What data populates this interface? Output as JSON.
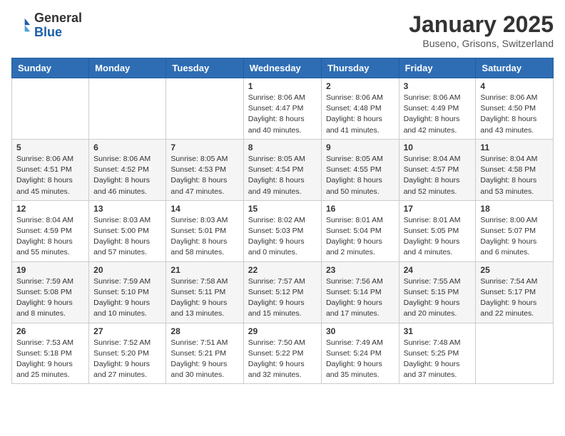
{
  "header": {
    "logo_general": "General",
    "logo_blue": "Blue",
    "month_title": "January 2025",
    "location": "Buseno, Grisons, Switzerland"
  },
  "days_of_week": [
    "Sunday",
    "Monday",
    "Tuesday",
    "Wednesday",
    "Thursday",
    "Friday",
    "Saturday"
  ],
  "weeks": [
    [
      {
        "day": "",
        "info": ""
      },
      {
        "day": "",
        "info": ""
      },
      {
        "day": "",
        "info": ""
      },
      {
        "day": "1",
        "info": "Sunrise: 8:06 AM\nSunset: 4:47 PM\nDaylight: 8 hours\nand 40 minutes."
      },
      {
        "day": "2",
        "info": "Sunrise: 8:06 AM\nSunset: 4:48 PM\nDaylight: 8 hours\nand 41 minutes."
      },
      {
        "day": "3",
        "info": "Sunrise: 8:06 AM\nSunset: 4:49 PM\nDaylight: 8 hours\nand 42 minutes."
      },
      {
        "day": "4",
        "info": "Sunrise: 8:06 AM\nSunset: 4:50 PM\nDaylight: 8 hours\nand 43 minutes."
      }
    ],
    [
      {
        "day": "5",
        "info": "Sunrise: 8:06 AM\nSunset: 4:51 PM\nDaylight: 8 hours\nand 45 minutes."
      },
      {
        "day": "6",
        "info": "Sunrise: 8:06 AM\nSunset: 4:52 PM\nDaylight: 8 hours\nand 46 minutes."
      },
      {
        "day": "7",
        "info": "Sunrise: 8:05 AM\nSunset: 4:53 PM\nDaylight: 8 hours\nand 47 minutes."
      },
      {
        "day": "8",
        "info": "Sunrise: 8:05 AM\nSunset: 4:54 PM\nDaylight: 8 hours\nand 49 minutes."
      },
      {
        "day": "9",
        "info": "Sunrise: 8:05 AM\nSunset: 4:55 PM\nDaylight: 8 hours\nand 50 minutes."
      },
      {
        "day": "10",
        "info": "Sunrise: 8:04 AM\nSunset: 4:57 PM\nDaylight: 8 hours\nand 52 minutes."
      },
      {
        "day": "11",
        "info": "Sunrise: 8:04 AM\nSunset: 4:58 PM\nDaylight: 8 hours\nand 53 minutes."
      }
    ],
    [
      {
        "day": "12",
        "info": "Sunrise: 8:04 AM\nSunset: 4:59 PM\nDaylight: 8 hours\nand 55 minutes."
      },
      {
        "day": "13",
        "info": "Sunrise: 8:03 AM\nSunset: 5:00 PM\nDaylight: 8 hours\nand 57 minutes."
      },
      {
        "day": "14",
        "info": "Sunrise: 8:03 AM\nSunset: 5:01 PM\nDaylight: 8 hours\nand 58 minutes."
      },
      {
        "day": "15",
        "info": "Sunrise: 8:02 AM\nSunset: 5:03 PM\nDaylight: 9 hours\nand 0 minutes."
      },
      {
        "day": "16",
        "info": "Sunrise: 8:01 AM\nSunset: 5:04 PM\nDaylight: 9 hours\nand 2 minutes."
      },
      {
        "day": "17",
        "info": "Sunrise: 8:01 AM\nSunset: 5:05 PM\nDaylight: 9 hours\nand 4 minutes."
      },
      {
        "day": "18",
        "info": "Sunrise: 8:00 AM\nSunset: 5:07 PM\nDaylight: 9 hours\nand 6 minutes."
      }
    ],
    [
      {
        "day": "19",
        "info": "Sunrise: 7:59 AM\nSunset: 5:08 PM\nDaylight: 9 hours\nand 8 minutes."
      },
      {
        "day": "20",
        "info": "Sunrise: 7:59 AM\nSunset: 5:10 PM\nDaylight: 9 hours\nand 10 minutes."
      },
      {
        "day": "21",
        "info": "Sunrise: 7:58 AM\nSunset: 5:11 PM\nDaylight: 9 hours\nand 13 minutes."
      },
      {
        "day": "22",
        "info": "Sunrise: 7:57 AM\nSunset: 5:12 PM\nDaylight: 9 hours\nand 15 minutes."
      },
      {
        "day": "23",
        "info": "Sunrise: 7:56 AM\nSunset: 5:14 PM\nDaylight: 9 hours\nand 17 minutes."
      },
      {
        "day": "24",
        "info": "Sunrise: 7:55 AM\nSunset: 5:15 PM\nDaylight: 9 hours\nand 20 minutes."
      },
      {
        "day": "25",
        "info": "Sunrise: 7:54 AM\nSunset: 5:17 PM\nDaylight: 9 hours\nand 22 minutes."
      }
    ],
    [
      {
        "day": "26",
        "info": "Sunrise: 7:53 AM\nSunset: 5:18 PM\nDaylight: 9 hours\nand 25 minutes."
      },
      {
        "day": "27",
        "info": "Sunrise: 7:52 AM\nSunset: 5:20 PM\nDaylight: 9 hours\nand 27 minutes."
      },
      {
        "day": "28",
        "info": "Sunrise: 7:51 AM\nSunset: 5:21 PM\nDaylight: 9 hours\nand 30 minutes."
      },
      {
        "day": "29",
        "info": "Sunrise: 7:50 AM\nSunset: 5:22 PM\nDaylight: 9 hours\nand 32 minutes."
      },
      {
        "day": "30",
        "info": "Sunrise: 7:49 AM\nSunset: 5:24 PM\nDaylight: 9 hours\nand 35 minutes."
      },
      {
        "day": "31",
        "info": "Sunrise: 7:48 AM\nSunset: 5:25 PM\nDaylight: 9 hours\nand 37 minutes."
      },
      {
        "day": "",
        "info": ""
      }
    ]
  ]
}
